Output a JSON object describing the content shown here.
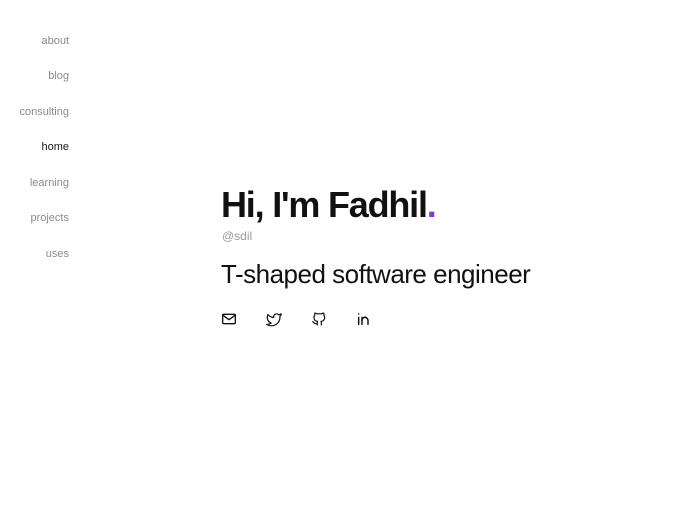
{
  "nav": {
    "items": [
      {
        "label": "about"
      },
      {
        "label": "blog"
      },
      {
        "label": "consulting"
      },
      {
        "label": "home"
      },
      {
        "label": "learning"
      },
      {
        "label": "projects"
      },
      {
        "label": "uses"
      }
    ],
    "active": "home"
  },
  "hero": {
    "title": "Hi, I'm Fadhil",
    "title_dot": ".",
    "handle": "@sdil",
    "subtitle": "T-shaped software engineer"
  },
  "social": {
    "links": [
      {
        "icon": "mail-icon"
      },
      {
        "icon": "twitter-icon"
      },
      {
        "icon": "github-icon"
      },
      {
        "icon": "linkedin-icon"
      }
    ]
  },
  "colors": {
    "accent": "#7c3aed",
    "text": "#111111",
    "muted": "#8a8a8a"
  }
}
